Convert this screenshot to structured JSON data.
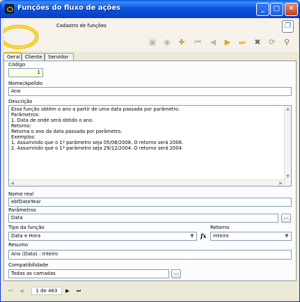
{
  "window": {
    "title": "Funções do fluxo de ações"
  },
  "header": {
    "title": "Cadastro de funções"
  },
  "tabs": [
    "Geral",
    "Cliente",
    "Servidor"
  ],
  "form": {
    "codigo_label": "Código",
    "codigo_value": "1",
    "nome_label": "Nome/Apelido",
    "nome_value": "Ano",
    "descricao_label": "Descrição",
    "descricao_lines": [
      "Essa função obtém o ano a partir de uma data passada por parâmetro.",
      "Parâmetros:",
      "1. Data de onde será obtido o ano.",
      "Retorno:",
      "Retorna o ano da data passada por parâmetro.",
      "Exemplos:",
      "1. Assumindo que o 1º parâmetro seja 05/08/2008. O retorno será 2008.",
      "2. Assumindo que o 1º parâmetro seja 29/12/2004. O retorno será 2004."
    ],
    "nome_real_label": "Nome real",
    "nome_real_value": "ebfDateYear",
    "parametros_label": "Parâmetros",
    "parametros_value": "Data",
    "tipo_label": "Tipo da função",
    "tipo_value": "Data e Hora",
    "fx_symbol": "fx",
    "retorno_label": "Retorno",
    "retorno_value": "Inteiro",
    "resumo_label": "Resumo",
    "resumo_value": "Ano (Data) : Inteiro",
    "compat_label": "Compatibilidade",
    "compat_value": "Todas as camadas",
    "ellipsis": "..."
  },
  "navigation": {
    "page_indicator": "1 de 463"
  }
}
